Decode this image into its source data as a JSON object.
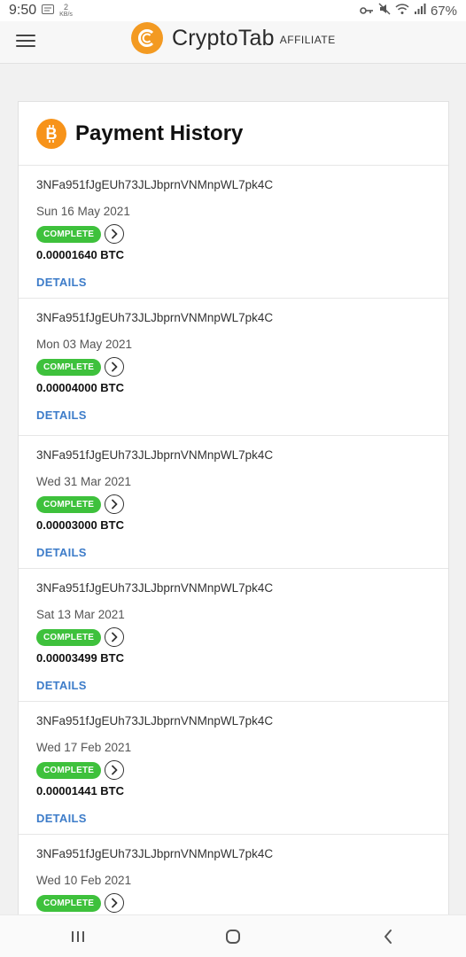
{
  "status_bar": {
    "time": "9:50",
    "net_speed_value": "2",
    "net_speed_unit": "KB/s",
    "battery": "67%"
  },
  "app": {
    "brand_name": "CryptoTab",
    "brand_suffix": "AFFILIATE",
    "accent_color": "#f39a22"
  },
  "page": {
    "title": "Payment History"
  },
  "payments": [
    {
      "address": "3NFa951fJgEUh73JLJbprnVNMnpWL7pk4C",
      "date": "Sun 16 May 2021",
      "status": "COMPLETE",
      "amount": "0.00001640 BTC",
      "details": "DETAILS"
    },
    {
      "address": "3NFa951fJgEUh73JLJbprnVNMnpWL7pk4C",
      "date": "Mon 03 May 2021",
      "status": "COMPLETE",
      "amount": "0.00004000 BTC",
      "details": "DETAILS"
    },
    {
      "address": "3NFa951fJgEUh73JLJbprnVNMnpWL7pk4C",
      "date": "Wed 31 Mar 2021",
      "status": "COMPLETE",
      "amount": "0.00003000 BTC",
      "details": "DETAILS"
    },
    {
      "address": "3NFa951fJgEUh73JLJbprnVNMnpWL7pk4C",
      "date": "Sat 13 Mar 2021",
      "status": "COMPLETE",
      "amount": "0.00003499 BTC",
      "details": "DETAILS"
    },
    {
      "address": "3NFa951fJgEUh73JLJbprnVNMnpWL7pk4C",
      "date": "Wed 17 Feb 2021",
      "status": "COMPLETE",
      "amount": "0.00001441 BTC",
      "details": "DETAILS"
    },
    {
      "address": "3NFa951fJgEUh73JLJbprnVNMnpWL7pk4C",
      "date": "Wed 10 Feb 2021",
      "status": "COMPLETE",
      "amount": "",
      "details": ""
    }
  ],
  "colors": {
    "complete": "#3ec13c",
    "link": "#3d7cc9",
    "bitcoin": "#f7931a"
  }
}
